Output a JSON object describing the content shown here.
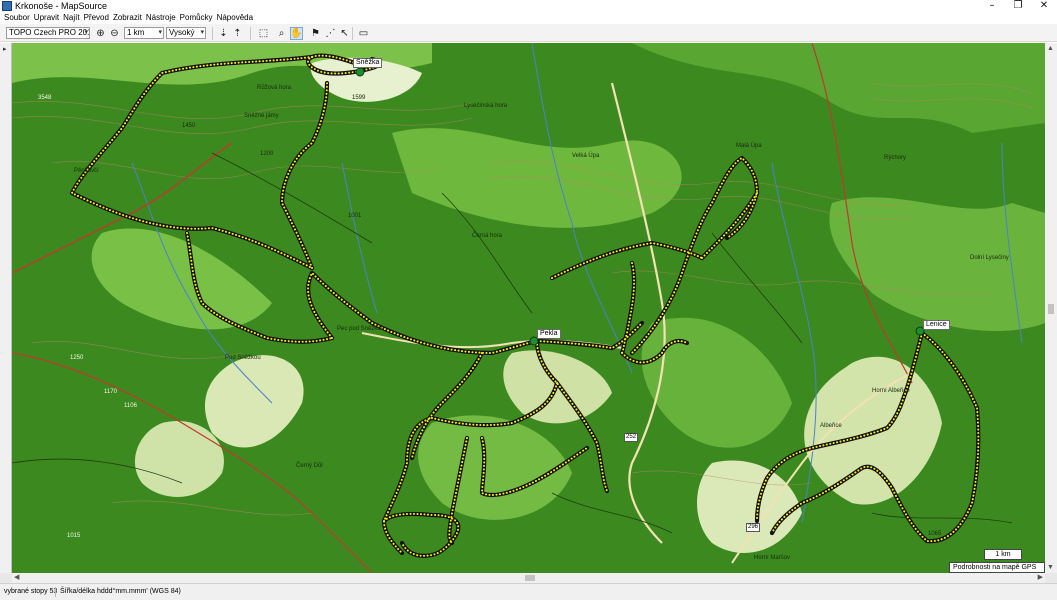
{
  "window": {
    "title": "Krkonoše - MapSource",
    "minimize_glyph": "–",
    "restore_glyph": "❐",
    "close_glyph": "✕"
  },
  "menu": [
    "Soubor",
    "Upravit",
    "Najít",
    "Převod",
    "Zobrazit",
    "Nástroje",
    "Pomůcky",
    "Nápověda"
  ],
  "toolbar": {
    "map_product": "TOPO Czech PRO 2011",
    "scale": "1 km",
    "detail": "Vysoký",
    "icons": [
      "zoom-in-icon",
      "zoom-out-icon",
      "receive-from-device-icon",
      "send-to-device-icon",
      "select-tool-icon",
      "zoom-tool-icon",
      "hand-pan-tool-icon",
      "waypoint-tool-icon",
      "route-tool-icon",
      "track-select-icon",
      "distance-ruler-icon"
    ]
  },
  "map": {
    "waypoints": [
      {
        "name": "Sněžka"
      },
      {
        "name": "Pekla"
      },
      {
        "name": "Lenice"
      }
    ],
    "road_numbers": [
      "252",
      "296"
    ],
    "place_labels": [
      "Pěnkavčí",
      "Růžová hora",
      "Sněžné jámy",
      "Pod Sněžkou",
      "Černý Důl",
      "Albeřice",
      "Horní Albeřice",
      "Pec pod Sněžkou",
      "Lysečinská hora",
      "Černá hora",
      "Malá Úpa",
      "Rýchory",
      "Velká Úpa",
      "Horní Maršov",
      "Dolní Lysečiny"
    ],
    "elevation_labels": [
      "3548",
      "1599",
      "1450",
      "1001",
      "1250",
      "1170",
      "1015",
      "1200",
      "1106",
      "1065"
    ],
    "scale_text": "1 km",
    "gps_detail_text": "Podrobnosti na mapě GPS",
    "colors": {
      "forest": "#3c8a1f",
      "forest_light": "#6fb83e",
      "meadow": "#d9e8b5",
      "track": "#ffee00",
      "road_major": "#c0392b",
      "road_minor": "#f2e2b3",
      "water": "#4b82c9",
      "waypoint_marker": "#1e8f2c"
    }
  },
  "status": {
    "selection": "vybrané stopy 53",
    "coordinates_format": "Šířka/délka hddd°mm.mmm' (WGS 84)"
  }
}
